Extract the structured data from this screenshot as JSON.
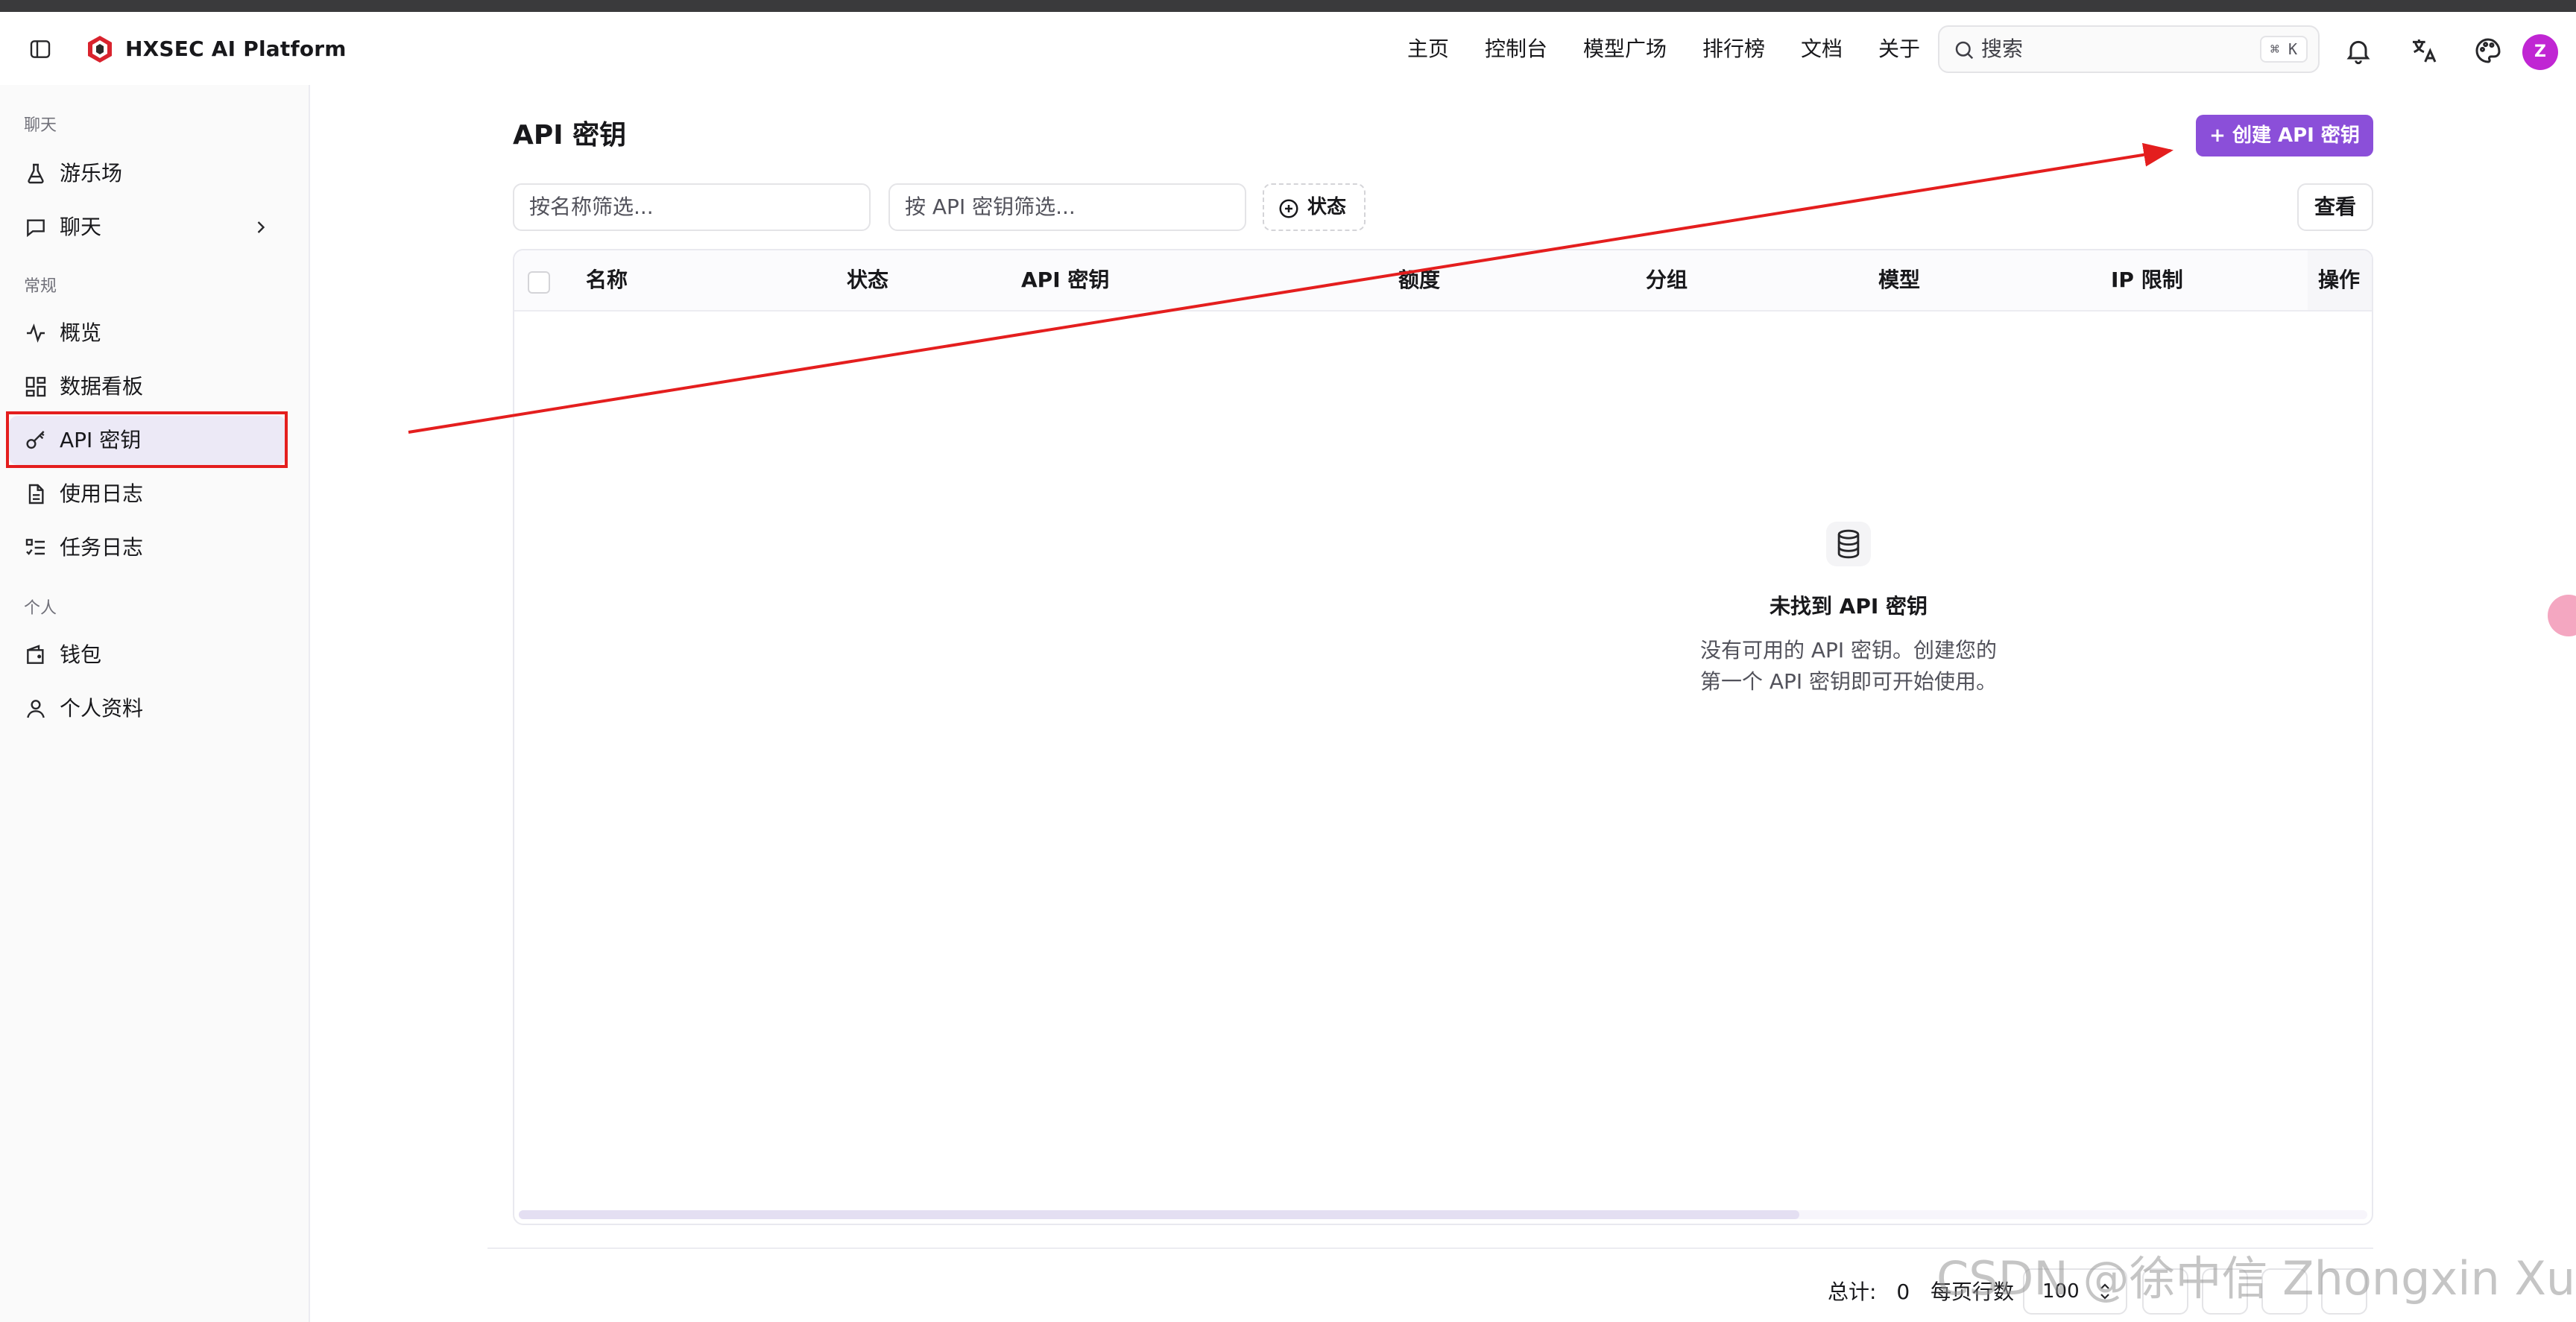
{
  "header": {
    "brand": "HXSEC AI Platform",
    "nav": [
      "主页",
      "控制台",
      "模型广场",
      "排行榜",
      "文档",
      "关于"
    ],
    "search": {
      "placeholder": "搜索",
      "shortcut": "⌘ K"
    },
    "avatar_initial": "Z"
  },
  "sidebar": {
    "groups": [
      "聊天",
      "常规",
      "个人"
    ],
    "items": [
      {
        "label": "游乐场",
        "icon": "flask-icon"
      },
      {
        "label": "聊天",
        "icon": "message-icon"
      },
      {
        "label": "概览",
        "icon": "activity-icon"
      },
      {
        "label": "数据看板",
        "icon": "dashboard-icon"
      },
      {
        "label": "API 密钥",
        "icon": "key-icon"
      },
      {
        "label": "使用日志",
        "icon": "document-icon"
      },
      {
        "label": "任务日志",
        "icon": "list-check-icon"
      },
      {
        "label": "钱包",
        "icon": "wallet-icon"
      },
      {
        "label": "个人资料",
        "icon": "user-icon"
      }
    ],
    "active_item": "API 密钥"
  },
  "main": {
    "title": "API 密钥",
    "create_button": "创建 API 密钥",
    "filters": {
      "name_placeholder": "按名称筛选...",
      "key_placeholder": "按 API 密钥筛选...",
      "status_label": "状态"
    },
    "view_button": "查看",
    "table": {
      "columns": [
        "名称",
        "状态",
        "API 密钥",
        "额度",
        "分组",
        "模型",
        "IP 限制",
        "操作"
      ],
      "rows": []
    },
    "empty": {
      "title": "未找到 API 密钥",
      "line1": "没有可用的 API 密钥。创建您的",
      "line2": "第一个 API 密钥即可开始使用。"
    },
    "footer": {
      "total_label": "总计:",
      "total_value": "0",
      "rows_per_page_label": "每页行数",
      "rows_per_page_value": "100"
    }
  },
  "watermark": "CSDN @徐中信 Zhongxin Xu",
  "colors": {
    "accent": "#8b4fd9",
    "active_bg": "#ece9f6",
    "annotation": "#e41e1e",
    "avatar": "#c026d3"
  }
}
